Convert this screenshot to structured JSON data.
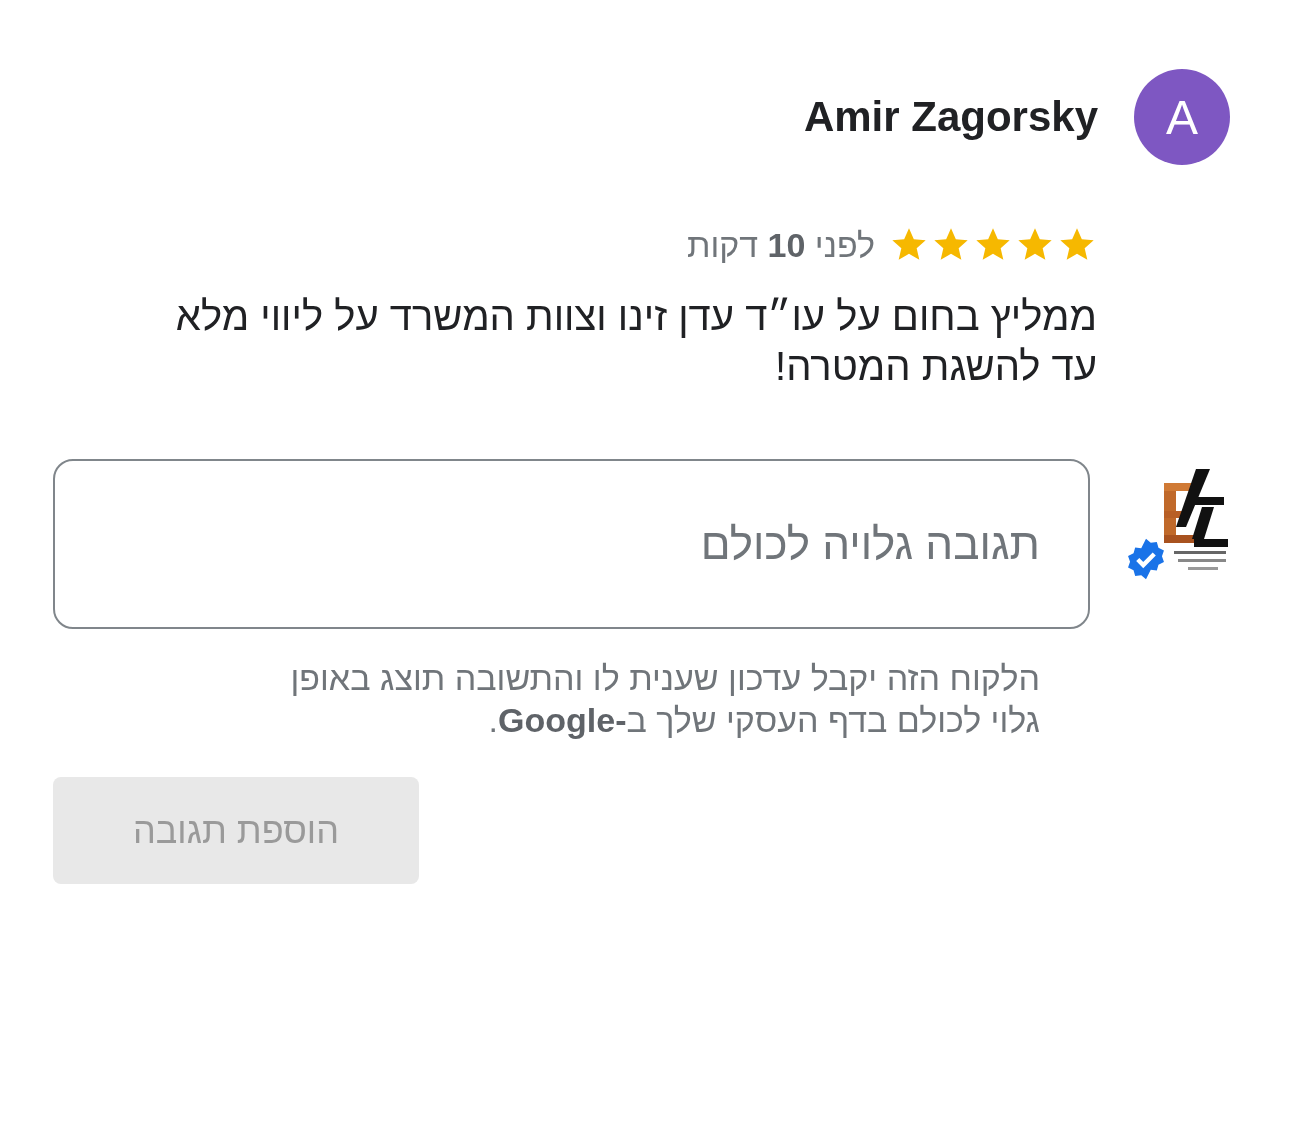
{
  "reviewer": {
    "name": "Amir Zagorsky",
    "initial": "A"
  },
  "review": {
    "stars": 5,
    "time": "לפני **10** דקות",
    "text": "ממליץ בחום על עו״ד עדן זינו וצוות המשרד על ליווי מלא עד להשגת המטרה!"
  },
  "reply": {
    "owner_verified": true,
    "placeholder": "תגובה גלויה לכולם",
    "note": "הלקוח הזה יקבל עדכון שענית לו והתשובה תוצג באופן גלוי לכולם בדף העסקי שלך ב**-Google**.",
    "button": {
      "label": "הוספת תגובה",
      "disabled": true
    }
  }
}
